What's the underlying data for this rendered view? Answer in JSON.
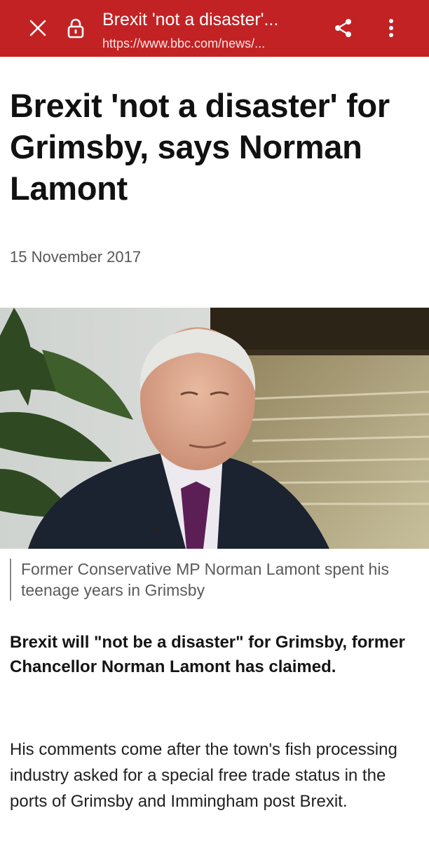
{
  "browser_bar": {
    "title": "Brexit 'not a disaster'...",
    "url": "https://www.bbc.com/news/...",
    "background_color": "#c22224",
    "icons": {
      "close": "close-icon",
      "lock": "lock-icon",
      "share": "share-icon",
      "more": "more-vert-icon"
    }
  },
  "article": {
    "headline": "Brexit 'not a disaster' for Grimsby, says Norman Lamont",
    "date": "15 November 2017",
    "image_caption": "Former Conservative MP Norman Lamont spent his teenage years in Grimsby",
    "lede": "Brexit will \"not be a disaster\" for Grimsby, former Chancellor Norman Lamont has claimed.",
    "paragraphs": [
      "His comments come after the town's fish processing industry asked for a special free trade status in the ports of Grimsby and Immingham post Brexit."
    ]
  }
}
